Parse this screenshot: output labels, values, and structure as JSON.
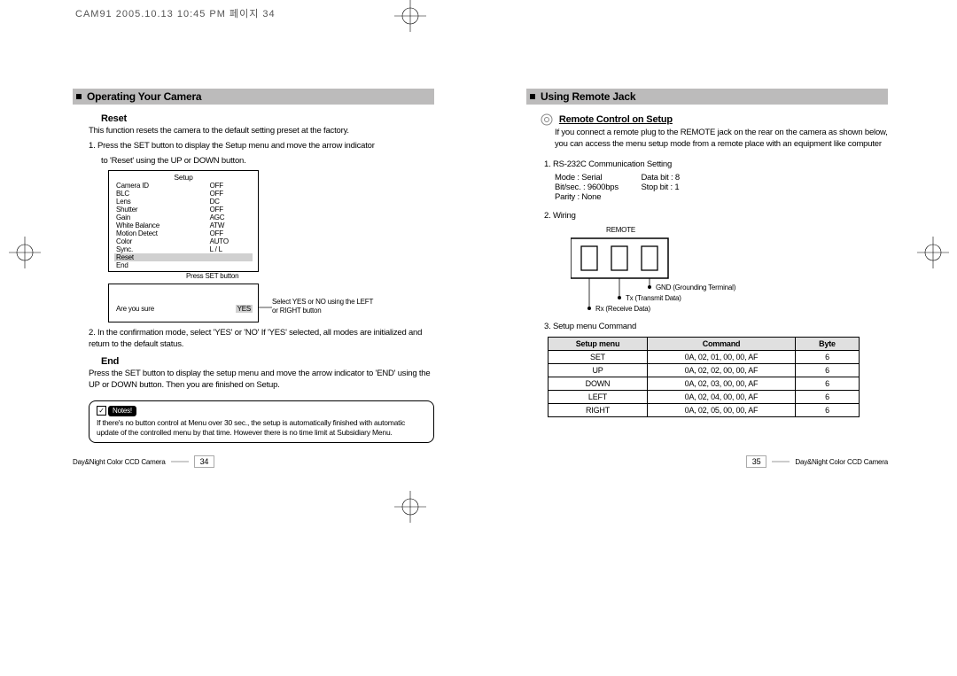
{
  "header": "CAM91  2005.10.13 10:45 PM  페이지 34",
  "left": {
    "section_title": "Operating Your Camera",
    "reset": {
      "head": "Reset",
      "intro": "This function resets the camera to the default setting preset at the factory.",
      "step1": "1. Press the SET button to display the Setup menu and move the arrow indicator",
      "step1b": "to 'Reset' using the UP or DOWN button.",
      "menu_title": "Setup",
      "menu": [
        [
          "Camera ID",
          "OFF"
        ],
        [
          "BLC",
          "OFF"
        ],
        [
          "Lens",
          "DC"
        ],
        [
          "Shutter",
          "OFF"
        ],
        [
          "Gain",
          "AGC"
        ],
        [
          "White Balance",
          "ATW"
        ],
        [
          "Motion Detect",
          "OFF"
        ],
        [
          "Color",
          "AUTO"
        ],
        [
          "Sync.",
          "L / L"
        ],
        [
          "Reset",
          ""
        ],
        [
          "End",
          ""
        ]
      ],
      "press_set": "Press SET button",
      "confirm_q": "Are you sure",
      "confirm_yes": "YES",
      "confirm_side": "Select YES or NO using the LEFT or RIGHT button",
      "step2": "2. In the confirmation mode, select 'YES' or 'NO' If 'YES' selected, all modes are initialized and return to the default status."
    },
    "end": {
      "head": "End",
      "text": "Press the SET button to display the setup menu and move the arrow indicator to 'END' using the UP or DOWN button. Then you are finished on Setup."
    },
    "notes": {
      "label": "Notes!",
      "text": "If there's no button control at Menu over 30 sec., the setup is automatically finished with automatic update of the controlled menu by that time. However there is no time limit at Subsidiary Menu."
    },
    "footer_text": "Day&Night Color CCD Camera",
    "footer_page": "34"
  },
  "right": {
    "section_title": "Using Remote Jack",
    "remote": {
      "head": "Remote Control on Setup",
      "intro": "If you connect a remote plug to the REMOTE jack on the rear on the camera as shown below, you can access the menu setup mode from a remote place with an equipment like computer",
      "rs232_head": "1. RS-232C Communication Setting",
      "rs232_a": "Mode : Serial",
      "rs232_b": "Data bit : 8",
      "rs232_c": "Bit/sec. : 9600bps",
      "rs232_d": "Stop bit : 1",
      "rs232_e": "Parity : None",
      "wiring_head": "2. Wiring",
      "wiring_label": "REMOTE",
      "wiring_gnd": "GND (Grounding Terminal)",
      "wiring_tx": "Tx (Transmit Data)",
      "wiring_rx": "Rx (Receive Data)",
      "cmd_head": "3. Setup menu Command",
      "table": {
        "headers": [
          "Setup menu",
          "Command",
          "Byte"
        ],
        "rows": [
          [
            "SET",
            "0A, 02, 01, 00, 00, AF",
            "6"
          ],
          [
            "UP",
            "0A, 02, 02, 00, 00, AF",
            "6"
          ],
          [
            "DOWN",
            "0A, 02, 03, 00, 00, AF",
            "6"
          ],
          [
            "LEFT",
            "0A, 02, 04, 00, 00, AF",
            "6"
          ],
          [
            "RIGHT",
            "0A, 02, 05, 00, 00, AF",
            "6"
          ]
        ]
      }
    },
    "footer_text": "Day&Night Color CCD Camera",
    "footer_page": "35"
  }
}
